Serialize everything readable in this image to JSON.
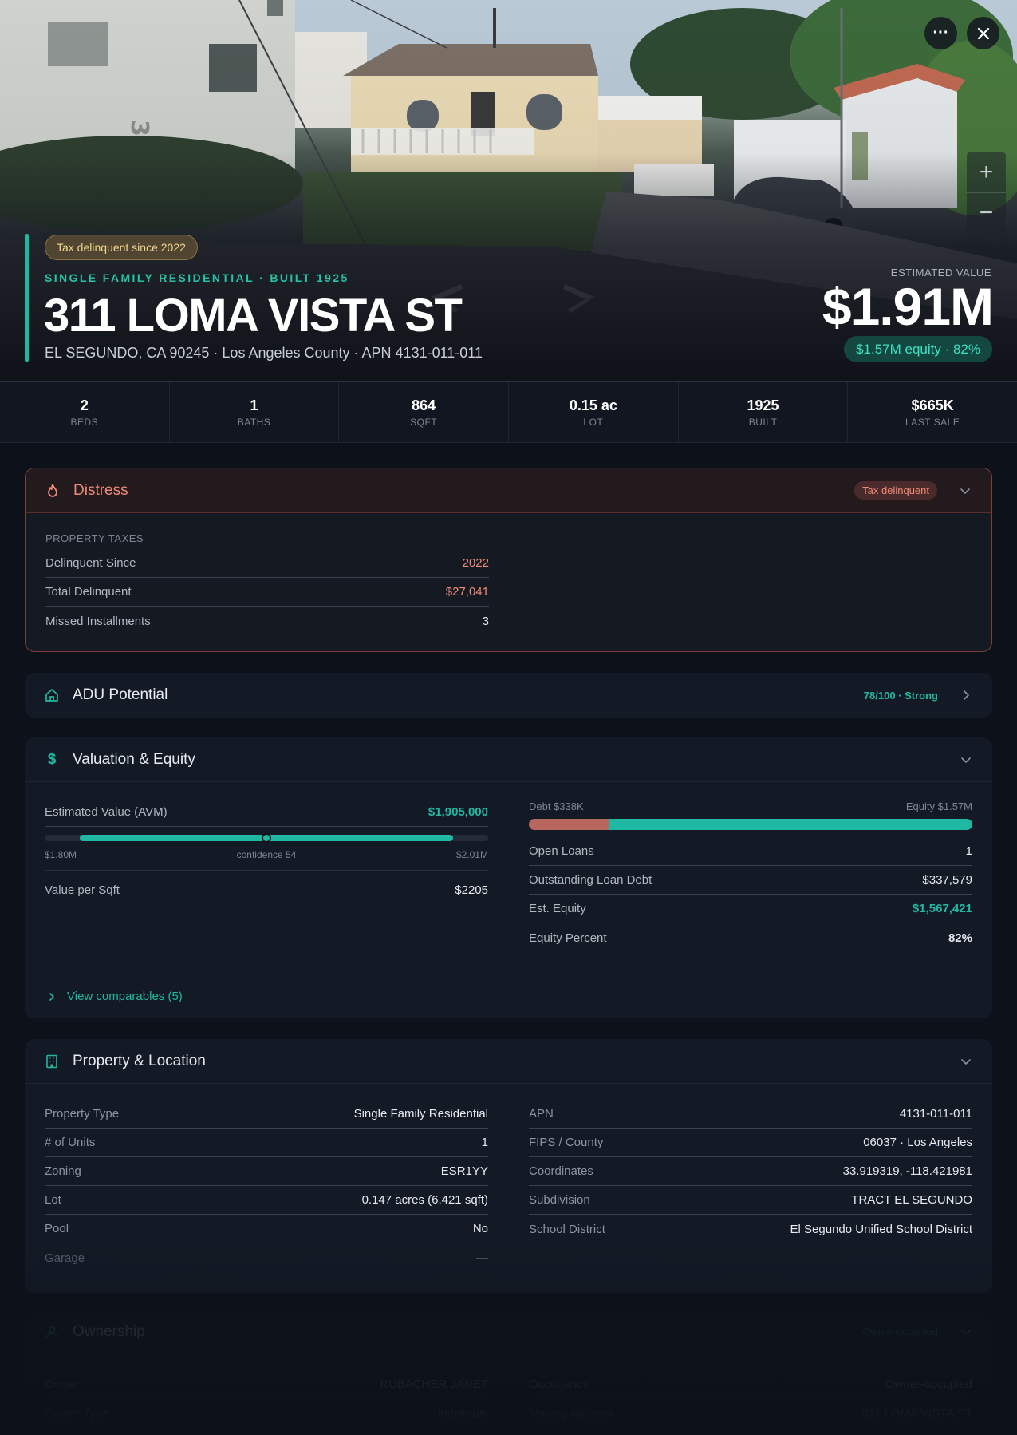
{
  "hero": {
    "tax_badge": "Tax delinquent since 2022",
    "subtitle": "SINGLE FAMILY RESIDENTIAL · BUILT 1925",
    "title": "311 LOMA VISTA ST",
    "address_line": "EL SEGUNDO, CA 90245 · Los Angeles County · APN 4131-011-011",
    "estimated_label": "ESTIMATED VALUE",
    "estimated_value": "$1.91M",
    "equity_badge": "$1.57M equity · 82%",
    "house_number_sign": "305",
    "buttons": {
      "more_icon": "more-dots-icon",
      "close_icon": "close-icon"
    },
    "zoom": {
      "in": "+",
      "out": "−"
    }
  },
  "stats": [
    {
      "value": "2",
      "label": "BEDS"
    },
    {
      "value": "1",
      "label": "BATHS"
    },
    {
      "value": "864",
      "label": "SQFT"
    },
    {
      "value": "0.15 ac",
      "label": "LOT"
    },
    {
      "value": "1925",
      "label": "BUILT"
    },
    {
      "value": "$665K",
      "label": "LAST SALE"
    }
  ],
  "distress": {
    "title": "Distress",
    "badge": "Tax delinquent",
    "section": "PROPERTY TAXES",
    "rows": [
      {
        "k": "Delinquent Since",
        "v": "2022"
      },
      {
        "k": "Total Delinquent",
        "v": "$27,041"
      },
      {
        "k": "Missed Installments",
        "v": "3"
      }
    ]
  },
  "adu": {
    "title": "ADU Potential",
    "badge": "78/100 · Strong"
  },
  "valuation": {
    "title": "Valuation & Equity",
    "avm_label": "Estimated Value (AVM)",
    "avm_value": "$1,905,000",
    "range_low": "$1.80M",
    "range_mid": "confidence 54",
    "range_high": "$2.01M",
    "range_marker_fraction": 0.5,
    "vps_label": "Value per Sqft",
    "vps_value": "$2205",
    "debt_label": "Debt $338K",
    "equity_label": "Equity $1.57M",
    "equity_fraction": 0.82,
    "rows": [
      {
        "k": "Open Loans",
        "v": "1"
      },
      {
        "k": "Outstanding Loan Debt",
        "v": "$337,579"
      },
      {
        "k": "Est. Equity",
        "v": "$1,567,421"
      },
      {
        "k": "Equity Percent",
        "v": "82%"
      }
    ],
    "comparables_link": "View comparables (5)"
  },
  "property": {
    "title": "Property & Location",
    "left": [
      {
        "k": "Property Type",
        "v": "Single Family Residential"
      },
      {
        "k": "# of Units",
        "v": "1"
      },
      {
        "k": "Zoning",
        "v": "ESR1YY"
      },
      {
        "k": "Lot",
        "v": "0.147 acres (6,421 sqft)"
      },
      {
        "k": "Pool",
        "v": "No"
      },
      {
        "k": "Garage",
        "v": "—"
      }
    ],
    "right": [
      {
        "k": "APN",
        "v": "4131-011-011"
      },
      {
        "k": "FIPS / County",
        "v": "06037 · Los Angeles"
      },
      {
        "k": "Coordinates",
        "v": "33.919319, -118.421981"
      },
      {
        "k": "Subdivision",
        "v": "TRACT EL SEGUNDO"
      },
      {
        "k": "School District",
        "v": "El Segundo Unified School District"
      }
    ]
  },
  "ownership": {
    "title": "Ownership",
    "badge": "Owner-occupied",
    "left": [
      {
        "k": "Owner",
        "v": "RUBACHER JANET"
      },
      {
        "k": "Owner Type",
        "v": "Individual"
      }
    ],
    "right": [
      {
        "k": "Occupancy",
        "v": "Owner-occupied"
      },
      {
        "k": "Mailing Address",
        "v": "311 LOMA VISTA ST"
      }
    ]
  },
  "colors": {
    "accent": "#1fb8a2",
    "distress": "#f08a78",
    "debt_bar": "#b8675f",
    "equity_bar": "#1fb8a2"
  }
}
